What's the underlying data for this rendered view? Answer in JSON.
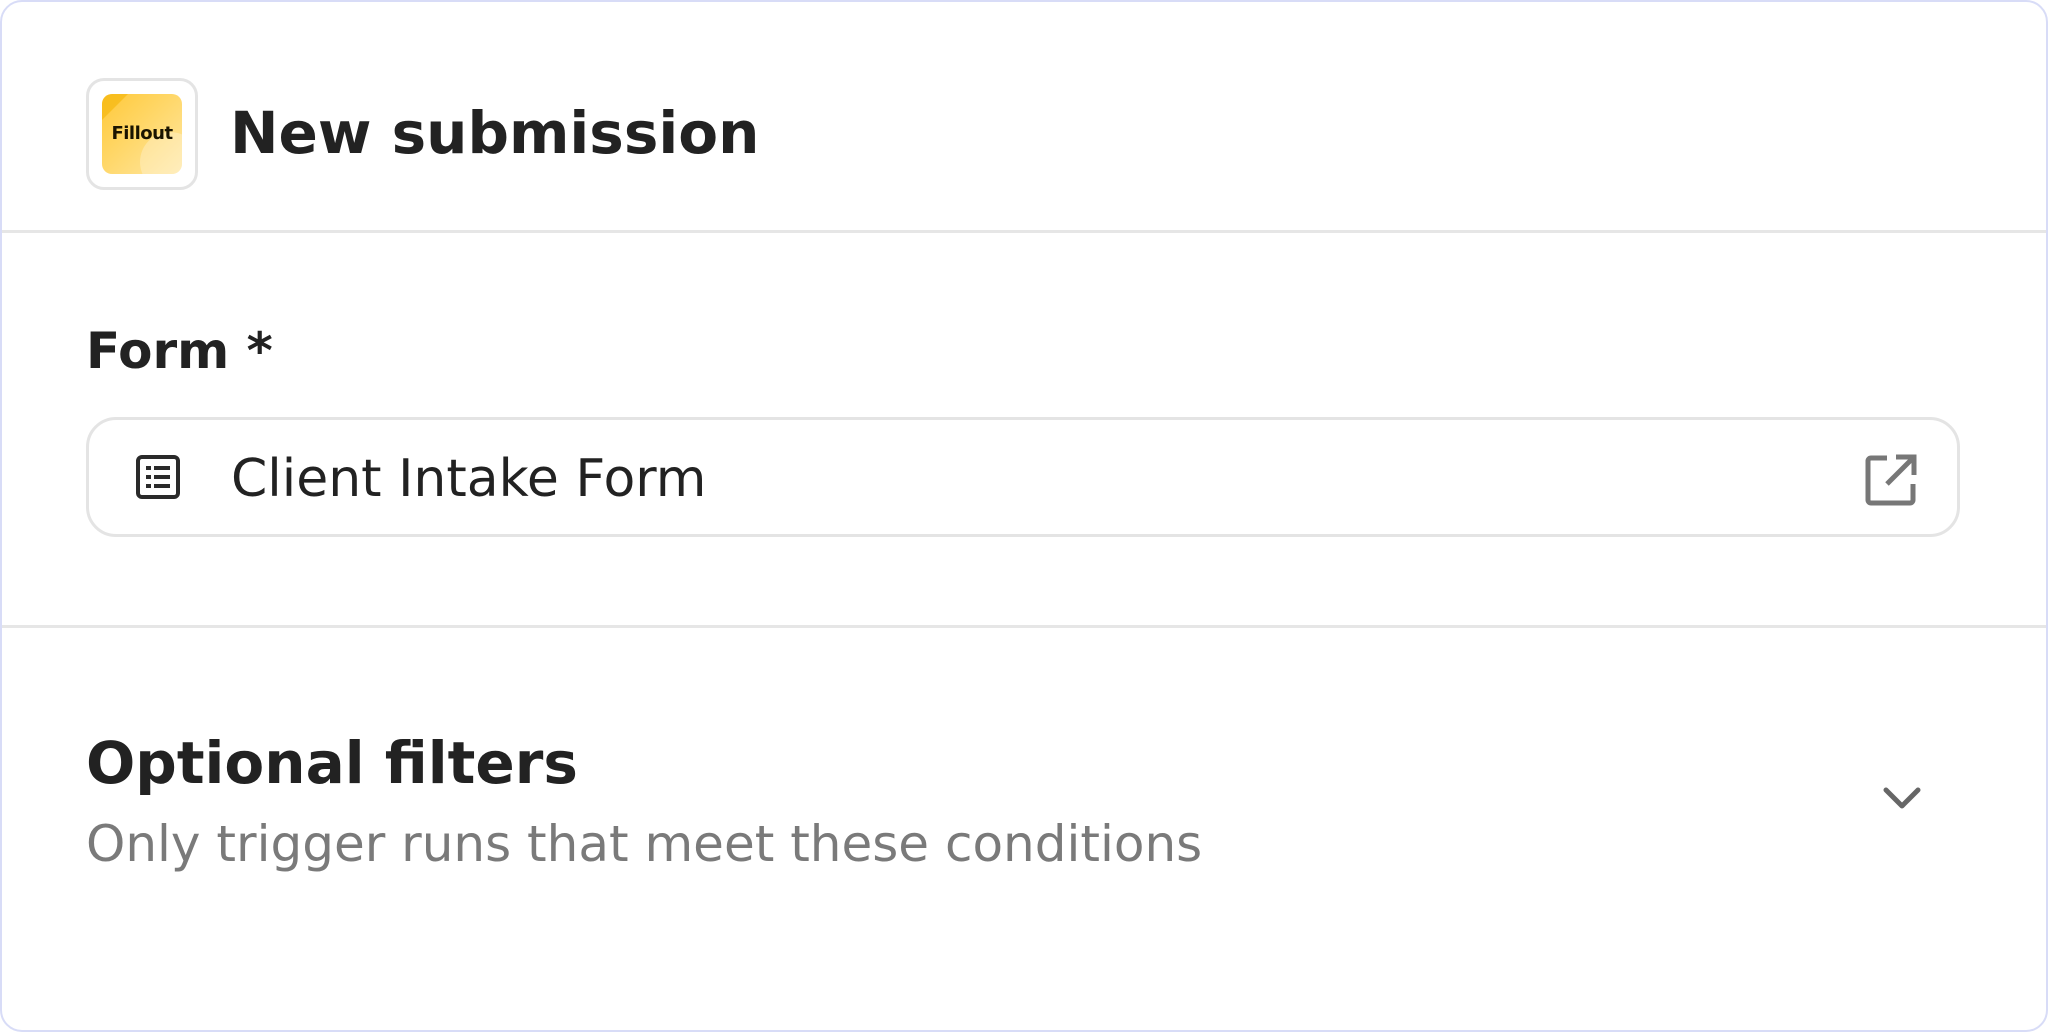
{
  "header": {
    "logo_text": "Fillout",
    "title": "New submission"
  },
  "form": {
    "label": "Form *",
    "value": "Client Intake Form",
    "icon": "list-icon",
    "action_icon": "open-external-icon"
  },
  "filters": {
    "title": "Optional filters",
    "subtitle": "Only trigger runs that meet these conditions",
    "toggle_icon": "chevron-down-icon"
  },
  "colors": {
    "border_accent": "#d8dcf7",
    "divider": "#e6e6e6",
    "logo_yellow": "#ffc93a",
    "muted_text": "#7a7a7a"
  }
}
